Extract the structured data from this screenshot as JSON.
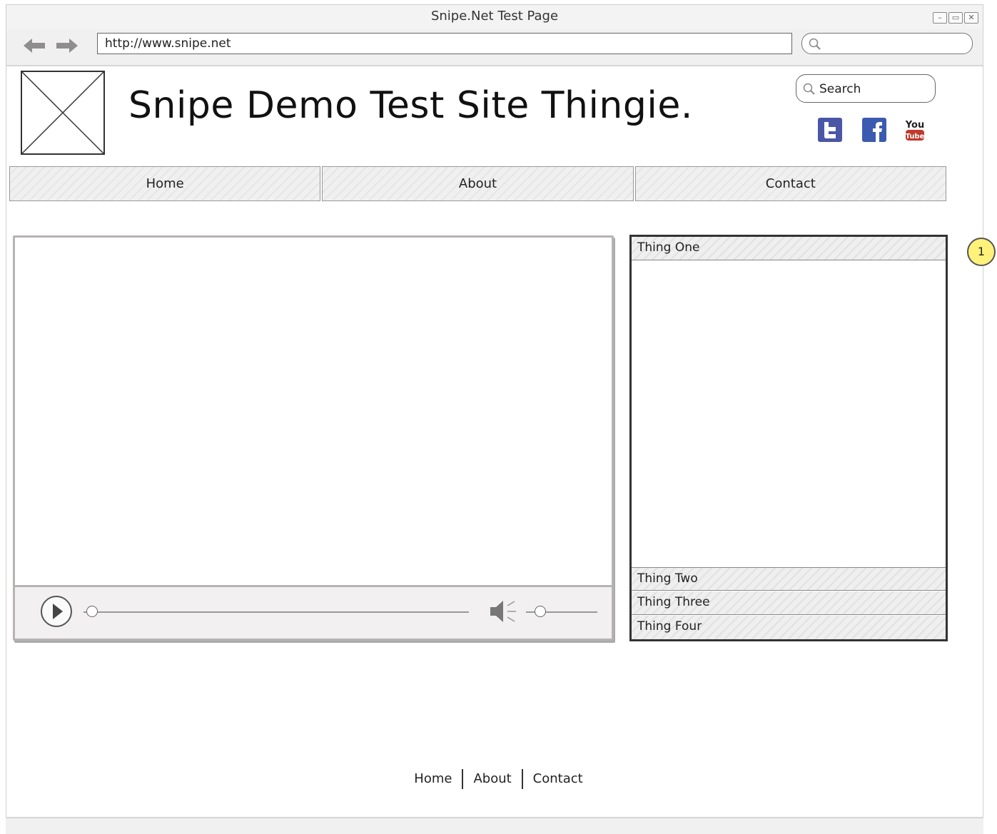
{
  "browser": {
    "title": "Snipe.Net Test Page",
    "url": "http://www.snipe.net",
    "search_placeholder": "",
    "back_icon": "arrow-left-icon",
    "forward_icon": "arrow-right-icon",
    "window_controls": [
      "minimize-icon",
      "maximize-icon",
      "close-icon"
    ]
  },
  "site": {
    "title": "Snipe Demo Test Site Thingie.",
    "search_placeholder": "Search",
    "social": [
      {
        "name": "twitter-icon",
        "color": "#4a57a6"
      },
      {
        "name": "facebook-icon",
        "color": "#3b5bb0"
      },
      {
        "name": "youtube-icon",
        "color": "#c0392b"
      }
    ]
  },
  "nav": {
    "items": [
      {
        "label": "Home"
      },
      {
        "label": "About"
      },
      {
        "label": "Contact"
      }
    ]
  },
  "video_player": {
    "play_icon": "play-icon",
    "mute_icon": "speaker-icon",
    "seek_position": 0.0,
    "volume": 0.1
  },
  "accordion": {
    "items": [
      {
        "label": "Thing One",
        "expanded": true
      },
      {
        "label": "Thing Two",
        "expanded": false
      },
      {
        "label": "Thing Three",
        "expanded": false
      },
      {
        "label": "Thing Four",
        "expanded": false
      }
    ]
  },
  "annotation": {
    "badge": "1",
    "color": "#fff27a"
  },
  "footer": {
    "links": [
      {
        "label": "Home"
      },
      {
        "label": "About"
      },
      {
        "label": "Contact"
      }
    ]
  }
}
